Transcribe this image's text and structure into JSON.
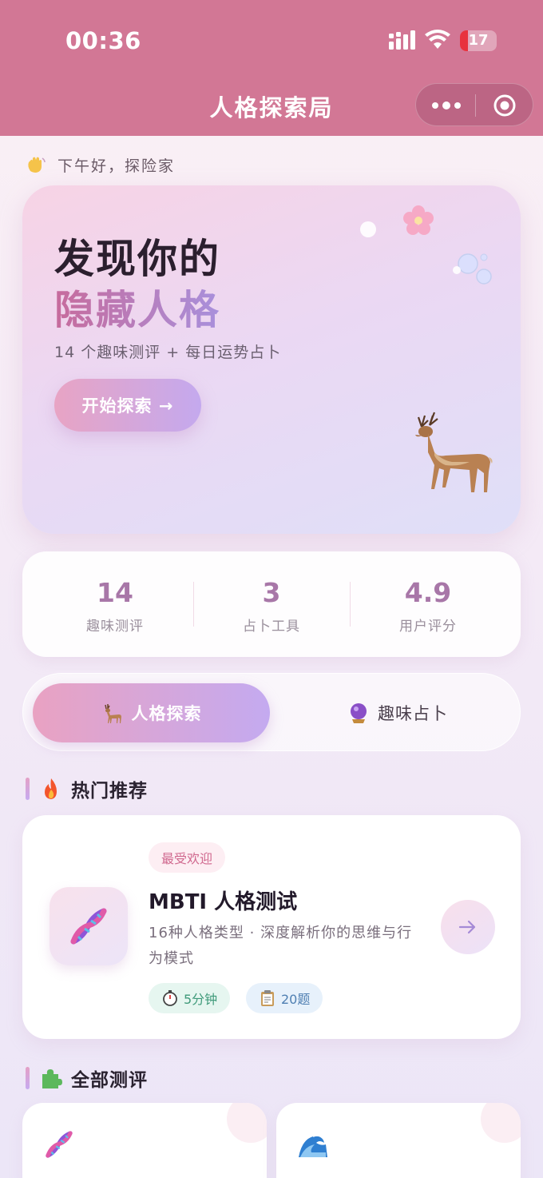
{
  "status_bar": {
    "time": "00:36",
    "battery": "17",
    "battery_color": "#e8323e"
  },
  "nav": {
    "title": "人格探索局",
    "more_icon": "more-dots-icon",
    "close_icon": "target-circle-icon",
    "bar_color": "#d27795"
  },
  "greeting": {
    "emoji": "waving-hand-icon",
    "text": "下午好，探险家"
  },
  "hero": {
    "line1": "发现你的",
    "line2": "隐藏人格",
    "subtitle": "14 个趣味测评 + 每日运势占卜",
    "button_label": "开始探索 →",
    "decorations": [
      "cherry-blossom-icon",
      "bubbles-icon",
      "deer-icon"
    ]
  },
  "stats": [
    {
      "value": "14",
      "label": "趣味测评"
    },
    {
      "value": "3",
      "label": "占卜工具"
    },
    {
      "value": "4.9",
      "label": "用户评分"
    }
  ],
  "tabs": [
    {
      "icon": "deer-icon",
      "label": "人格探索",
      "active": true
    },
    {
      "icon": "crystal-ball-icon",
      "label": "趣味占卜",
      "active": false
    }
  ],
  "sections": {
    "hot": {
      "icon": "fire-icon",
      "title": "热门推荐"
    },
    "all": {
      "icon": "puzzle-icon",
      "title": "全部测评"
    }
  },
  "featured": {
    "icon": "dna-icon",
    "badge": "最受欢迎",
    "title": "MBTI 人格测试",
    "description": "16种人格类型 · 深度解析你的思维与行为模式",
    "duration": "5分钟",
    "questions": "20题",
    "duration_icon": "stopwatch-icon",
    "questions_icon": "clipboard-icon"
  },
  "all_tests": [
    {
      "icon": "dna-icon"
    },
    {
      "icon": "wave-icon"
    }
  ]
}
